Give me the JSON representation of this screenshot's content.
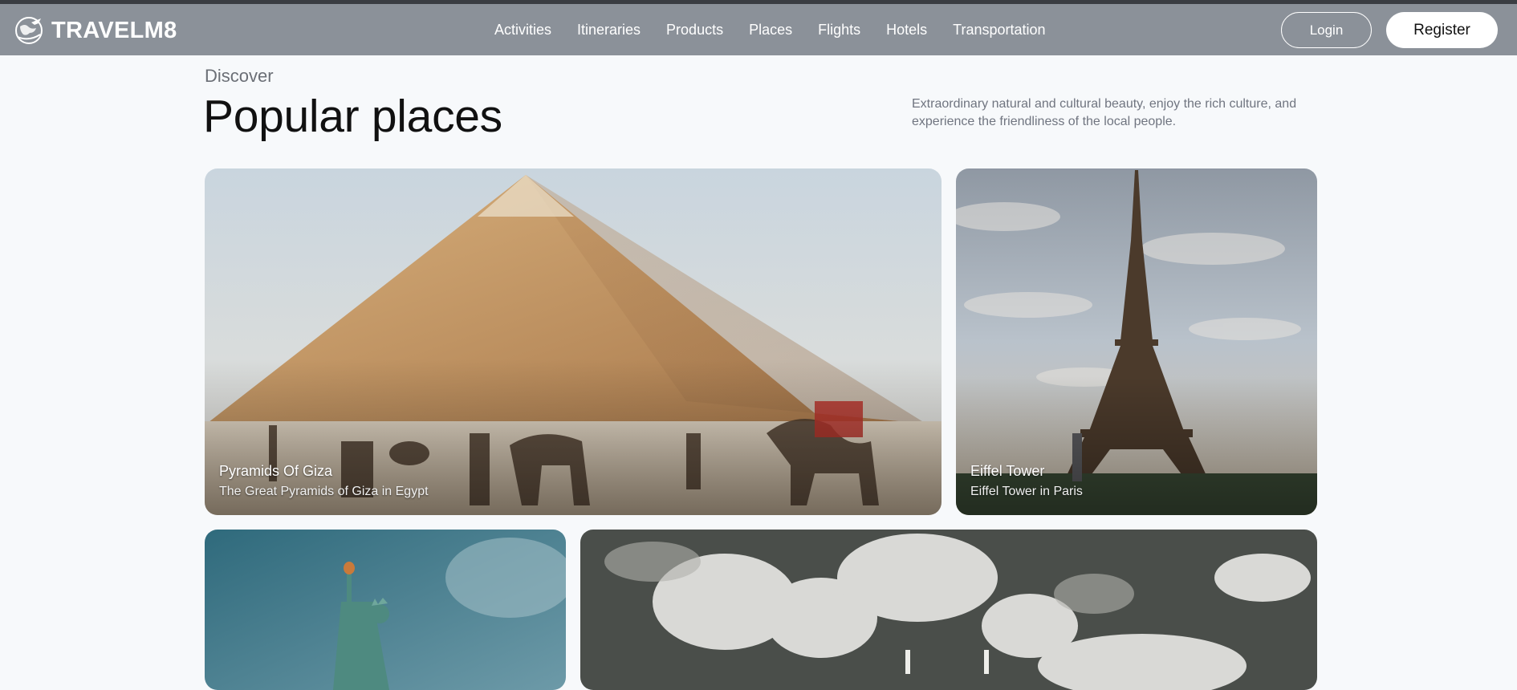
{
  "brand": {
    "name": "TRAVELM8",
    "icon": "globe-plane-icon"
  },
  "nav": {
    "links": [
      "Activities",
      "Itineraries",
      "Products",
      "Places",
      "Flights",
      "Hotels",
      "Transportation"
    ],
    "login_label": "Login",
    "register_label": "Register"
  },
  "section": {
    "eyebrow": "Discover",
    "title": "Popular places",
    "description": "Extraordinary natural and cultural beauty, enjoy the rich culture, and experience the friendliness of the local people."
  },
  "places": [
    {
      "name": "Pyramids Of Giza",
      "subtitle": "The Great Pyramids of Giza in Egypt"
    },
    {
      "name": "Eiffel Tower",
      "subtitle": "Eiffel Tower in Paris"
    }
  ],
  "colors": {
    "navbar": "#8b9199",
    "page_bg": "#f7f9fb",
    "accent_text": "#111111"
  }
}
